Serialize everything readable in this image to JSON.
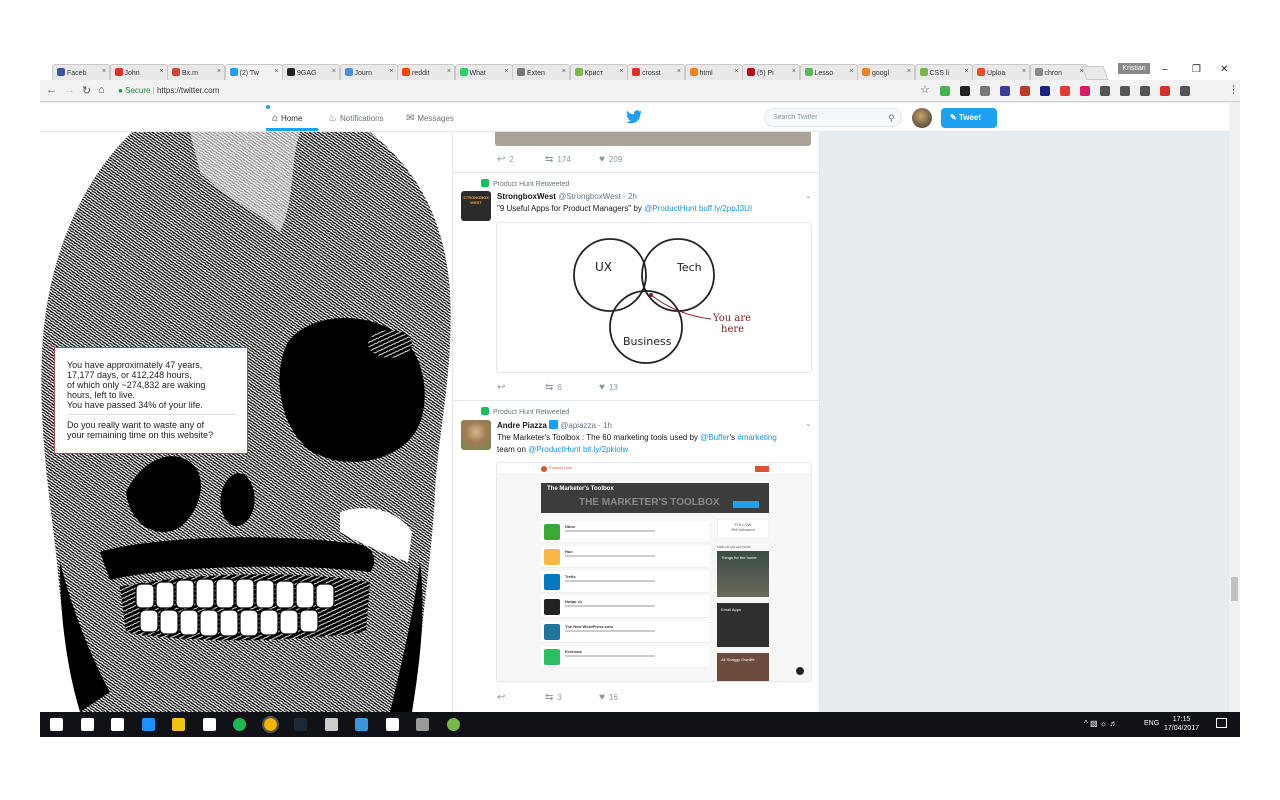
{
  "browser": {
    "tabs": [
      {
        "label": "Faceb",
        "color": "#3b5998"
      },
      {
        "label": "John",
        "color": "#e52d27"
      },
      {
        "label": "Bx.m",
        "color": "#d44638"
      },
      {
        "label": "(2) Tw",
        "color": "#1da1f2",
        "active": true
      },
      {
        "label": "9GAG",
        "color": "#222222"
      },
      {
        "label": "Journ",
        "color": "#4a90d9"
      },
      {
        "label": "reddit",
        "color": "#ff4500"
      },
      {
        "label": "What",
        "color": "#25d366"
      },
      {
        "label": "Exten",
        "color": "#777777"
      },
      {
        "label": "Крист",
        "color": "#7ab648"
      },
      {
        "label": "crosst",
        "color": "#e52d27"
      },
      {
        "label": "html",
        "color": "#f48024"
      },
      {
        "label": "(5) Pi",
        "color": "#bd081c"
      },
      {
        "label": "Lesso",
        "color": "#5cb85c"
      },
      {
        "label": "googl",
        "color": "#f48024"
      },
      {
        "label": "CSS li",
        "color": "#7ab648"
      },
      {
        "label": "Uploa",
        "color": "#e34f26"
      },
      {
        "label": "chron",
        "color": "#888888"
      }
    ],
    "user_badge": "Kristian",
    "secure_label": "Secure",
    "url": "https://twitter.com",
    "ext_colors": [
      "#4caf50",
      "#222222",
      "#777777",
      "#3b3b98",
      "#c0392b",
      "#1a237e",
      "#e53935",
      "#d81b60",
      "#555555",
      "#555555",
      "#555555",
      "#d32f2f",
      "#555555"
    ]
  },
  "twitter": {
    "nav": {
      "home": "Home",
      "notifications": "Notifications",
      "messages": "Messages"
    },
    "search_placeholder": "Search Twitter",
    "tweet_button": "Tweet",
    "brand_color": "#1da1f2"
  },
  "overlay": {
    "line1": "You have approximately 47 years,",
    "line2": "17,177 days, or 412,248 hours,",
    "line3": "of which only ~274,832 are waking",
    "line4": "hours, left to live.",
    "line5": "You have passed 34% of your life.",
    "question1": "Do you really want to waste any of",
    "question2": "your remaining time on this website?"
  },
  "top_actions": {
    "replies": "2",
    "retweets": "174",
    "likes": "209"
  },
  "tweet1": {
    "retweeted_by": "Product Hunt Retweeted",
    "name": "StrongboxWest",
    "handle": "@StrongboxWest · 2h",
    "text_plain": "\"9 Useful Apps for Product Managers\" by ",
    "text_link": "@ProductHunt buff.ly/2ppJ3UI",
    "avatar_text": "STRONGBOX WEST",
    "venn": {
      "a": "UX",
      "b": "Tech",
      "c": "Business",
      "note1": "You are",
      "note2": "here"
    },
    "replies": "",
    "retweets": "6",
    "likes": "13"
  },
  "tweet2": {
    "retweeted_by": "Product Hunt Retweeted",
    "name": "Andre Piazza",
    "handle": "@apiazza · 1h",
    "text_a": "The Marketer's Toolbox : The 60 marketing tools used by ",
    "text_link1": "@Buffer",
    "text_b": "'s ",
    "text_link2": "#marketing",
    "text_c": "team on ",
    "text_link3": "@ProductHunt bit.ly/2pkiolw",
    "card": {
      "site": "Product Hunt",
      "hero_title": "The Marketer's Toolbox",
      "hero_big": "THE MARKETER'S TOOLBOX",
      "follow": "FOLLOW",
      "followers": "359 followers",
      "similar": "SIMILAR COLLECTIONS",
      "side1": "Things for the home",
      "side2": "Email Apps",
      "side3": "All Shaggy Ownlife",
      "items": [
        {
          "name": "Ubox",
          "color": "#3aaa35"
        },
        {
          "name": "Hue",
          "color": "#f5b942"
        },
        {
          "name": "Trello",
          "color": "#0079bf"
        },
        {
          "name": "Hotjar v1",
          "color": "#222222"
        },
        {
          "name": "The New WordPress.com",
          "color": "#21759b"
        },
        {
          "name": "Evernote",
          "color": "#2dbe60"
        }
      ]
    },
    "replies": "",
    "retweets": "3",
    "likes": "16"
  },
  "taskbar": {
    "lang": "ENG",
    "time": "17:15",
    "date": "17/04/2017",
    "icon_colors": [
      "#ffffff",
      "#ffffff",
      "#ffffff",
      "#1e90ff",
      "#f1c40f",
      "#ffffff",
      "#1db954",
      "#f4b400",
      "#1b2838",
      "#cccccc",
      "#3a96dd",
      "#ffffff",
      "#999999",
      "#7ab648"
    ]
  }
}
